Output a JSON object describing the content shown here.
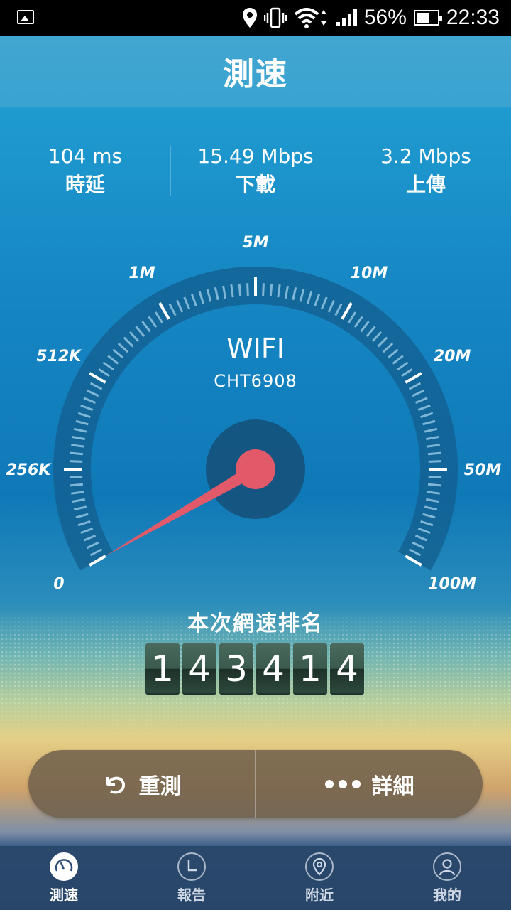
{
  "status_bar": {
    "battery": "56%",
    "time": "22:33"
  },
  "header": {
    "title": "測速"
  },
  "stats": [
    {
      "value": "104 ms",
      "label": "時延"
    },
    {
      "value": "15.49 Mbps",
      "label": "下載"
    },
    {
      "value": "3.2 Mbps",
      "label": "上傳"
    }
  ],
  "gauge": {
    "scale_labels": [
      "0",
      "256K",
      "512K",
      "1M",
      "5M",
      "10M",
      "20M",
      "50M",
      "100M"
    ],
    "network_type": "WIFI",
    "network_name": "CHT6908",
    "needle_position": 0.0,
    "colors": {
      "needle": "#e25a6a",
      "hub": "#154f78"
    }
  },
  "rank": {
    "label": "本次網速排名",
    "digits": [
      "1",
      "4",
      "3",
      "4",
      "1",
      "4"
    ]
  },
  "actions": {
    "retest_label": "重測",
    "details_label": "詳細"
  },
  "bottom_nav": [
    {
      "label": "測速",
      "icon": "speedometer-icon",
      "active": true
    },
    {
      "label": "報告",
      "icon": "clock-icon",
      "active": false
    },
    {
      "label": "附近",
      "icon": "location-pin-icon",
      "active": false
    },
    {
      "label": "我的",
      "icon": "person-icon",
      "active": false
    }
  ]
}
